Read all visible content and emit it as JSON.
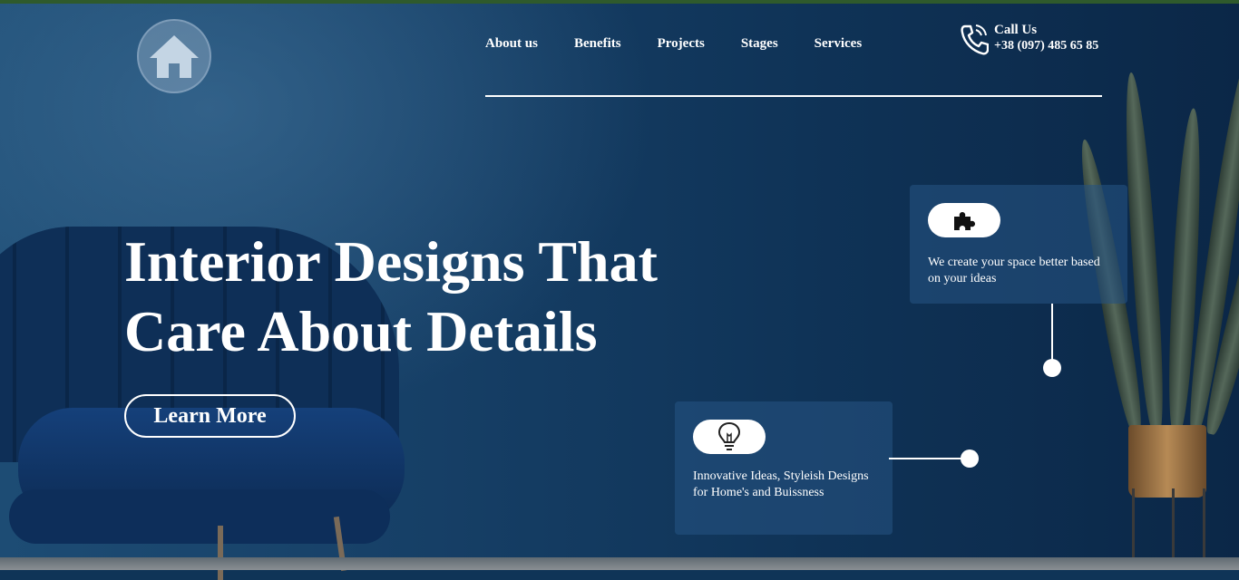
{
  "nav": {
    "items": [
      {
        "label": "About us"
      },
      {
        "label": "Benefits"
      },
      {
        "label": "Projects"
      },
      {
        "label": "Stages"
      },
      {
        "label": "Services"
      }
    ]
  },
  "contact": {
    "title": "Call Us",
    "phone": "+38 (097) 485 65 85"
  },
  "hero": {
    "headline_line1": "Interior Designs That",
    "headline_line2": "Care About Details",
    "cta_label": "Learn More"
  },
  "cards": [
    {
      "icon": "puzzle-icon",
      "text": "We create your space better based on your ideas"
    },
    {
      "icon": "lightbulb-icon",
      "text": "Innovative Ideas, Styleish Designs for Home's and Buissness"
    }
  ],
  "colors": {
    "topbar": "#2f5a2c",
    "background": "#0f3457",
    "card": "#255280"
  }
}
